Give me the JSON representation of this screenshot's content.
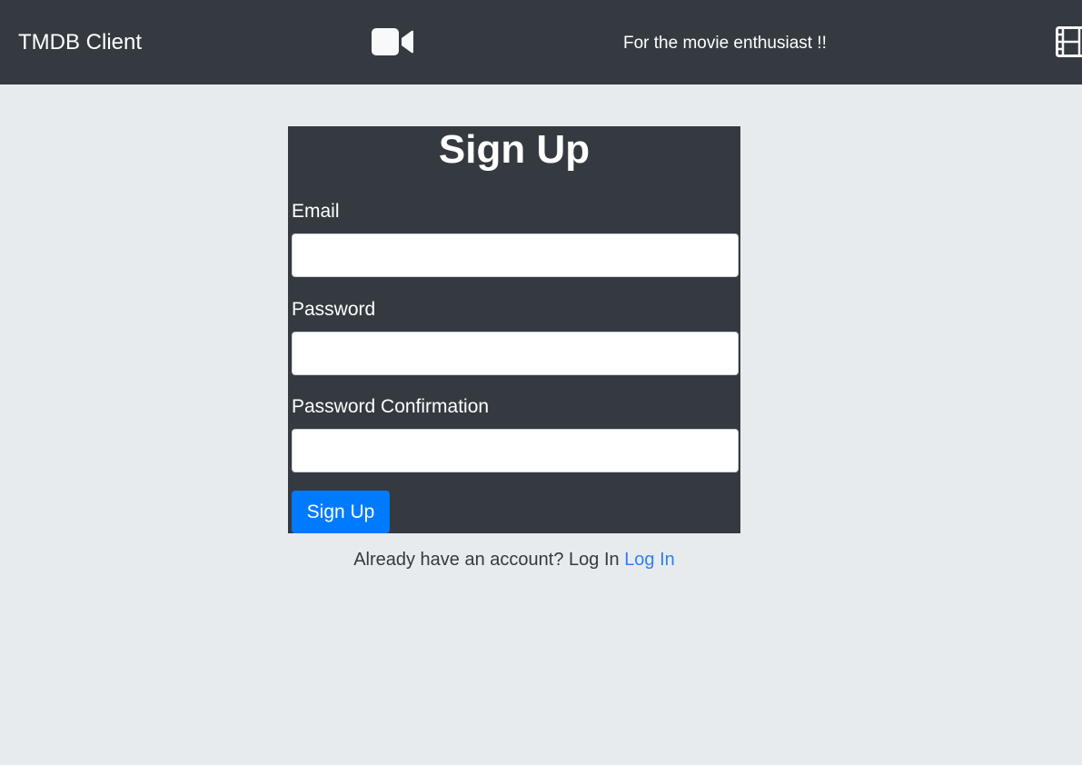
{
  "navbar": {
    "brand": "TMDB Client",
    "tagline": "For the movie enthusiast !!",
    "icons": [
      "video-camera-icon",
      "film-icon"
    ]
  },
  "form": {
    "title": "Sign Up",
    "email_label": "Email",
    "email_value": "",
    "password_label": "Password",
    "password_value": "",
    "confirmation_label": "Password Confirmation",
    "confirmation_value": "",
    "submit_label": "Sign Up"
  },
  "footer": {
    "prompt": "Already have an account? Log In",
    "link_label": "Log In"
  },
  "colors": {
    "navbar_bg": "#343a40",
    "page_bg": "#e8ebee",
    "primary": "#007bff",
    "link": "#2f80ed"
  }
}
